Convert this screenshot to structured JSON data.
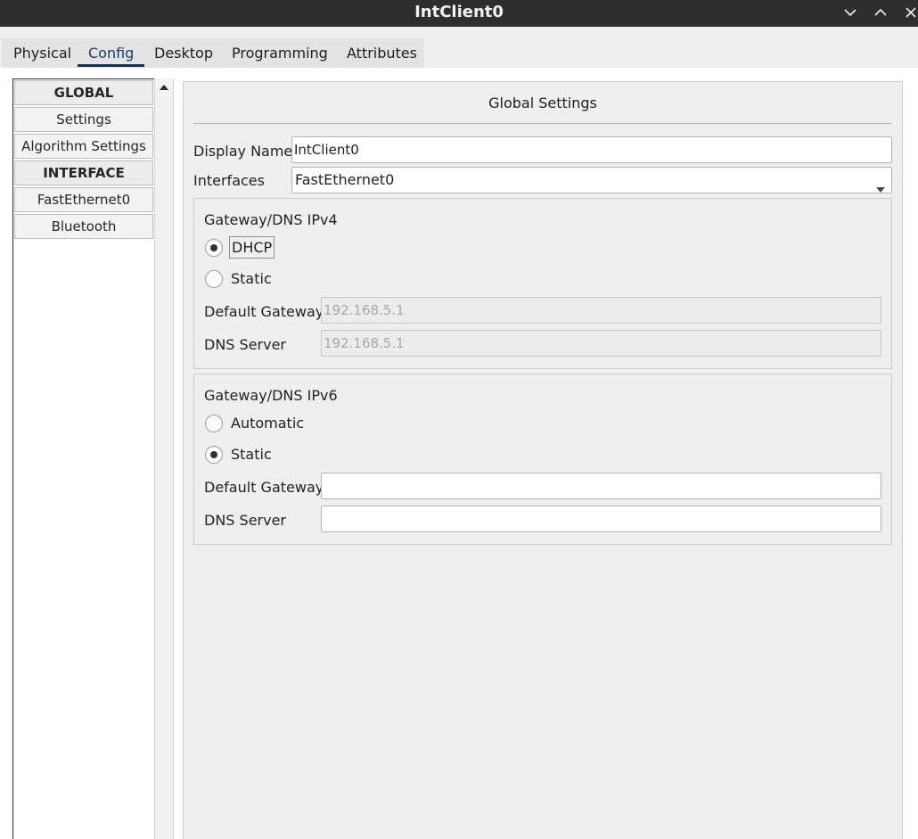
{
  "window": {
    "title": "IntClient0",
    "controls": [
      "chevron-down-icon",
      "chevron-up-icon",
      "close-icon"
    ]
  },
  "tabs": [
    {
      "label": "Physical",
      "active": false
    },
    {
      "label": "Config",
      "active": true
    },
    {
      "label": "Desktop",
      "active": false
    },
    {
      "label": "Programming",
      "active": false
    },
    {
      "label": "Attributes",
      "active": false
    }
  ],
  "sidebar": {
    "items": [
      {
        "label": "GLOBAL",
        "header": true
      },
      {
        "label": "Settings",
        "header": false
      },
      {
        "label": "Algorithm Settings",
        "header": false
      },
      {
        "label": "INTERFACE",
        "header": true
      },
      {
        "label": "FastEthernet0",
        "header": false
      },
      {
        "label": "Bluetooth",
        "header": false
      }
    ]
  },
  "panel": {
    "title": "Global Settings",
    "display_name_label": "Display Name",
    "display_name_value": "IntClient0",
    "interfaces_label": "Interfaces",
    "interfaces_value": "FastEthernet0"
  },
  "ipv4": {
    "title": "Gateway/DNS IPv4",
    "dhcp_label": "DHCP",
    "static_label": "Static",
    "selected": "DHCP",
    "gateway_label": "Default Gateway",
    "gateway_placeholder": "192.168.5.1",
    "dns_label": "DNS Server",
    "dns_placeholder": "192.168.5.1"
  },
  "ipv6": {
    "title": "Gateway/DNS IPv6",
    "automatic_label": "Automatic",
    "static_label": "Static",
    "selected": "Static",
    "gateway_label": "Default Gateway",
    "gateway_value": "",
    "dns_label": "DNS Server",
    "dns_value": ""
  },
  "colors": {
    "titlebar": "#2e2e2e",
    "tab_underline": "#17314f",
    "focus_ring": "#3eaec6"
  }
}
